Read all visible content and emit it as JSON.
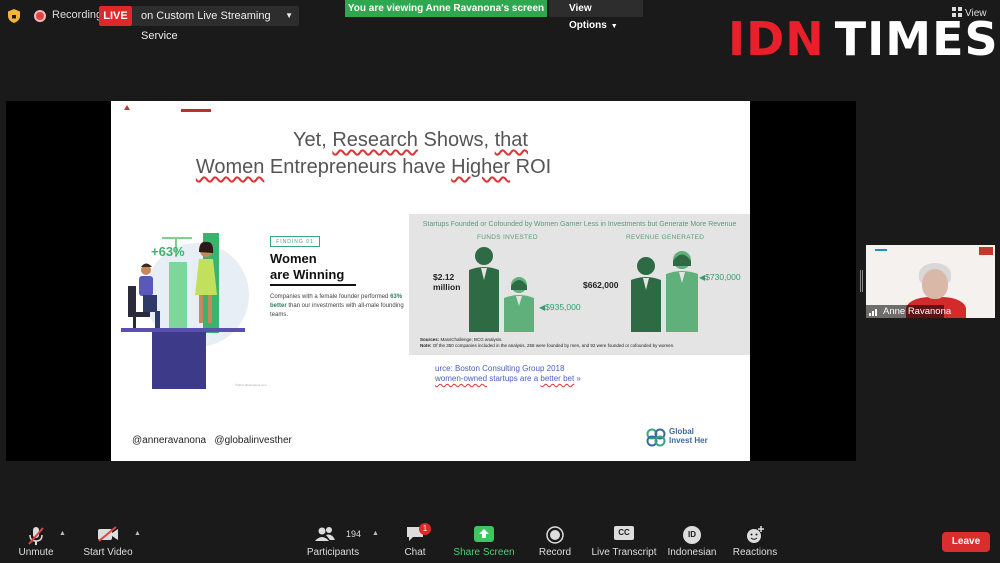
{
  "topbar": {
    "recording_label": "Recording",
    "live_badge": "LIVE",
    "streaming_label": "on Custom Live Streaming Service",
    "viewing_banner": "You are viewing Anne Ravanona's screen",
    "view_options_label": "View Options",
    "view_label": "View"
  },
  "watermark": {
    "part1": "IDN",
    "part2": "TIMES"
  },
  "slide": {
    "title_line1_prefix": "Yet, ",
    "title_line1_word1": "Research",
    "title_line1_mid": " Shows, ",
    "title_line1_word2": "that",
    "title_line2_word1": "Women",
    "title_line2_mid": " Entrepreneurs have ",
    "title_line2_word2": "Higher",
    "title_line2_suffix": " ROI",
    "illustration_stat": "+63%",
    "finding_tag": "FINDING 01",
    "winning_line1": "Women",
    "winning_line2": "are Winning",
    "body_part1": "Companies with a female founder performed ",
    "body_bold": "63% better",
    "body_part2": " than our investments with all-male founding teams.",
    "illustration_credit": "©Qifun illustrations.com",
    "bcg": {
      "title": "Startups Founded or Cofounded by Women Garner Less in Investments but Generate More Revenue",
      "funds_label": "FUNDS INVESTED",
      "revenue_label": "REVENUE GENERATED",
      "funds_men_value": "$2.12",
      "funds_men_unit": "million",
      "funds_women_value": "$935,000",
      "revenue_men_value": "$662,000",
      "revenue_women_value": "$730,000",
      "sources_label": "Sources:",
      "sources_text": " MassChallenge; BCG analysis.",
      "note_label": "Note:",
      "note_text": " Of the 350 companies included in the analysis, 258 were founded by men, and 92 were founded or cofounded by women."
    },
    "source_line1": "urce: Boston Consulting Group 2018",
    "source_line2_word1": "women-owned",
    "source_line2_mid": " startups are a ",
    "source_line2_word2": "better bet",
    "source_line2_suffix": " »",
    "handles": "@anneravanona   @globalinvesther",
    "logo_line1": "Global",
    "logo_line2": "Invest Her"
  },
  "participant_thumbnail": {
    "name": "Anne Ravanona"
  },
  "toolbar": {
    "unmute": "Unmute",
    "start_video": "Start Video",
    "participants": "Participants",
    "participant_count": "194",
    "chat": "Chat",
    "chat_badge": "1",
    "share_screen": "Share Screen",
    "record": "Record",
    "live_transcript": "Live Transcript",
    "live_transcript_icon": "CC",
    "language": "Indonesian",
    "language_icon": "ID",
    "reactions": "Reactions",
    "leave": "Leave"
  },
  "colors": {
    "background": "#1a1a1a",
    "live_red": "#e02828",
    "banner_green": "#2ea84f",
    "share_green": "#4fcf6f",
    "idn_red": "#e9202b",
    "bcg_dark_green": "#2e6b45",
    "bcg_light_green": "#5fb07a"
  }
}
